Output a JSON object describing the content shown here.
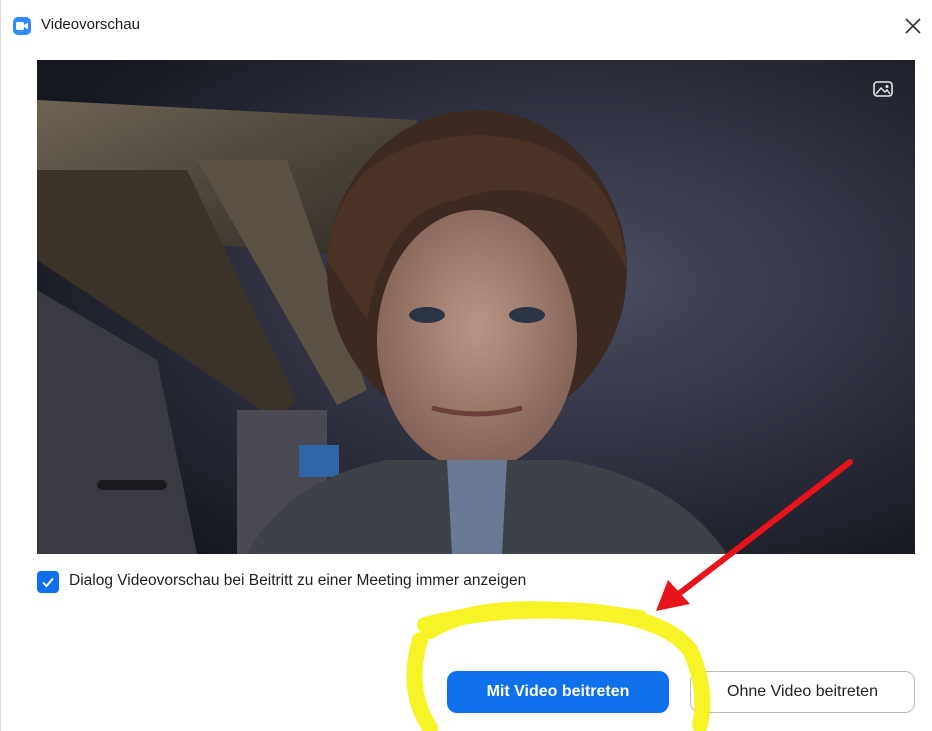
{
  "window": {
    "title": "Videovorschau",
    "app_icon": "zoom-camera-icon",
    "close_icon": "close-icon"
  },
  "video_preview": {
    "background_icon": "virtual-background-icon"
  },
  "options": {
    "always_show_preview_checked": true,
    "always_show_preview_label": "Dialog Videovorschau bei Beitritt zu einer Meeting immer anzeigen"
  },
  "actions": {
    "join_with_video": "Mit Video beitreten",
    "join_without_video": "Ohne Video beitreten"
  },
  "colors": {
    "accent": "#0e71eb",
    "highlight": "#f5f21a",
    "arrow": "#e8141b"
  }
}
